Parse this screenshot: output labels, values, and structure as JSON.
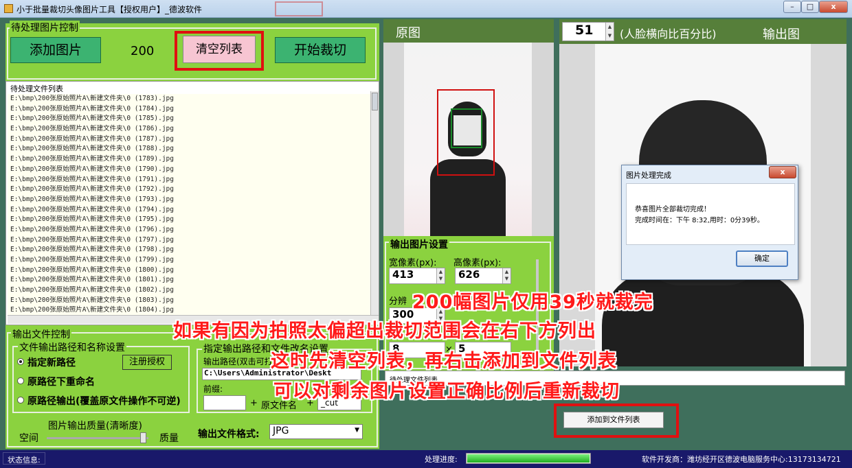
{
  "window": {
    "title": "小于批量裁切头像图片工具【授权用户】_德波软件",
    "minimize": "–",
    "maximize": "□",
    "close": "x"
  },
  "pending": {
    "group_label": "待处理图片控制",
    "add_button": "添加图片",
    "count": "200",
    "clear_button": "清空列表",
    "start_button": "开始裁切",
    "list_label": "待处理文件列表",
    "files": [
      "E:\\bmp\\200张原始照片A\\新建文件夹\\0 (1783).jpg",
      "E:\\bmp\\200张原始照片A\\新建文件夹\\0 (1784).jpg",
      "E:\\bmp\\200张原始照片A\\新建文件夹\\0 (1785).jpg",
      "E:\\bmp\\200张原始照片A\\新建文件夹\\0 (1786).jpg",
      "E:\\bmp\\200张原始照片A\\新建文件夹\\0 (1787).jpg",
      "E:\\bmp\\200张原始照片A\\新建文件夹\\0 (1788).jpg",
      "E:\\bmp\\200张原始照片A\\新建文件夹\\0 (1789).jpg",
      "E:\\bmp\\200张原始照片A\\新建文件夹\\0 (1790).jpg",
      "E:\\bmp\\200张原始照片A\\新建文件夹\\0 (1791).jpg",
      "E:\\bmp\\200张原始照片A\\新建文件夹\\0 (1792).jpg",
      "E:\\bmp\\200张原始照片A\\新建文件夹\\0 (1793).jpg",
      "E:\\bmp\\200张原始照片A\\新建文件夹\\0 (1794).jpg",
      "E:\\bmp\\200张原始照片A\\新建文件夹\\0 (1795).jpg",
      "E:\\bmp\\200张原始照片A\\新建文件夹\\0 (1796).jpg",
      "E:\\bmp\\200张原始照片A\\新建文件夹\\0 (1797).jpg",
      "E:\\bmp\\200张原始照片A\\新建文件夹\\0 (1798).jpg",
      "E:\\bmp\\200张原始照片A\\新建文件夹\\0 (1799).jpg",
      "E:\\bmp\\200张原始照片A\\新建文件夹\\0 (1800).jpg",
      "E:\\bmp\\200张原始照片A\\新建文件夹\\0 (1801).jpg",
      "E:\\bmp\\200张原始照片A\\新建文件夹\\0 (1802).jpg",
      "E:\\bmp\\200张原始照片A\\新建文件夹\\0 (1803).jpg",
      "E:\\bmp\\200张原始照片A\\新建文件夹\\0 (1804).jpg"
    ]
  },
  "output_control": {
    "group_label": "输出文件控制",
    "path_group_label": "文件输出路径和名称设置",
    "radio_new_path": "指定新路径",
    "radio_rename": "原路径下重命名",
    "radio_overwrite": "原路径输出(覆盖原文件操作不可逆)",
    "register_button": "注册授权",
    "specify_label": "指定输出路径和文件改名设置",
    "path_label": "输出路径(双击可打",
    "path_value": "C:\\Users\\Administrator\\Deskt",
    "prefix_label": "前缀:",
    "plus1": "+",
    "orig_name": "原文件名",
    "plus2": "+",
    "suffix_value": "_cut",
    "quality_label": "图片输出质量(清晰度)",
    "space_label": "空间",
    "quality_end": "质量",
    "format_label": "输出文件格式:",
    "format_value": "JPG"
  },
  "preview": {
    "original_label": "原图",
    "ratio_value": "51",
    "ratio_label": "(人脸横向比百分比)",
    "output_label": "输出图"
  },
  "image_settings": {
    "group_label": "输出图片设置",
    "width_label": "宽像素(px):",
    "height_label": "高像素(px):",
    "width_value": "413",
    "height_value": "626",
    "dpi_label": "分辨",
    "dpi_value": "300",
    "lower_left_value": "8",
    "times": "×",
    "lower_right_value": "5"
  },
  "dialog": {
    "title": "图片处理完成",
    "close": "x",
    "line1": "恭喜图片全部裁切完成！",
    "line2": "完成时间在：下午 8:32,用时：0分39秒。",
    "ok": "确定"
  },
  "bottom_right": {
    "list_label": "待处理文件列表",
    "add_button": "添加到文件列表"
  },
  "overlay": {
    "line1": "200幅图片仅用39秒就裁完",
    "line2": "如果有因为拍照太偏超出裁切范围会在右下方列出",
    "line3": "这时先清空列表，再右击添加到文件列表",
    "line4": "可以对剩余图片设置正确比例后重新裁切"
  },
  "statusbar": {
    "status_label": "状态信息:",
    "progress_label": "处理进度:",
    "progress": 1.0,
    "developer": "软件开发商：潍坊经开区德波电脑服务中心:13173134721"
  },
  "colors": {
    "panel_green": "#8bd23f",
    "dark_green": "#3f6f5c",
    "highlight_red": "#e01010",
    "status_navy": "#19196a"
  }
}
